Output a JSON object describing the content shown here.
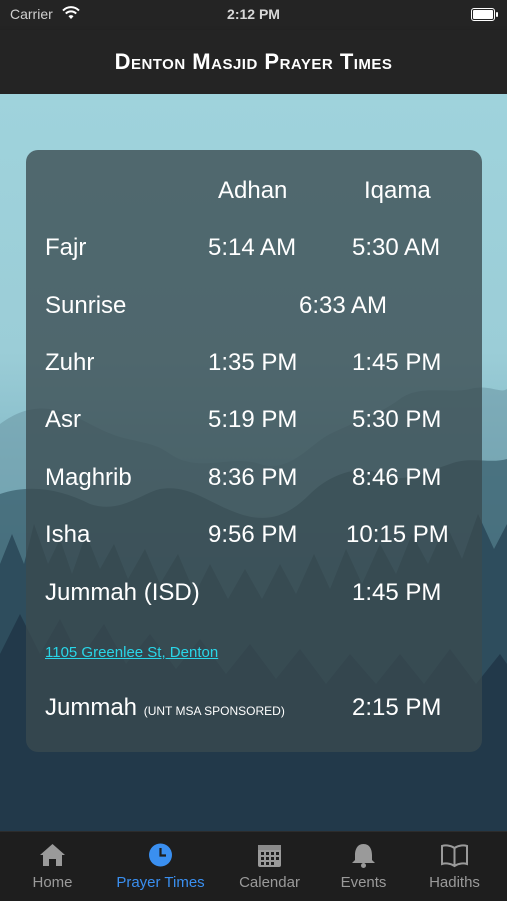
{
  "status_bar": {
    "carrier": "Carrier",
    "time": "2:12 PM"
  },
  "header": {
    "title": "Denton Masjid Prayer Times"
  },
  "table": {
    "col_adhan": "Adhan",
    "col_iqama": "Iqama",
    "rows": [
      {
        "name": "Fajr",
        "adhan": "5:14 AM",
        "iqama": "5:30 AM"
      },
      {
        "name": "Sunrise",
        "time": "6:33 AM"
      },
      {
        "name": "Zuhr",
        "adhan": "1:35 PM",
        "iqama": "1:45 PM"
      },
      {
        "name": "Asr",
        "adhan": "5:19 PM",
        "iqama": "5:30 PM"
      },
      {
        "name": "Maghrib",
        "adhan": "8:36 PM",
        "iqama": "8:46 PM"
      },
      {
        "name": "Isha",
        "adhan": "9:56 PM",
        "iqama": "10:15 PM"
      },
      {
        "name": "Jummah (ISD)",
        "iqama": "1:45 PM"
      }
    ],
    "address": "1105 Greenlee St, Denton",
    "jummah2": {
      "name": "Jummah",
      "note": "(UNT MSA SPONSORED)",
      "iqama": "2:15 PM"
    }
  },
  "tabs": [
    {
      "label": "Home",
      "icon": "home-icon"
    },
    {
      "label": "Prayer Times",
      "icon": "clock-icon",
      "active": true
    },
    {
      "label": "Calendar",
      "icon": "calendar-icon"
    },
    {
      "label": "Events",
      "icon": "bell-icon"
    },
    {
      "label": "Hadiths",
      "icon": "book-icon"
    }
  ],
  "colors": {
    "active_tab": "#3a8ff0",
    "link": "#29d6e8",
    "header_bg": "#242424"
  }
}
